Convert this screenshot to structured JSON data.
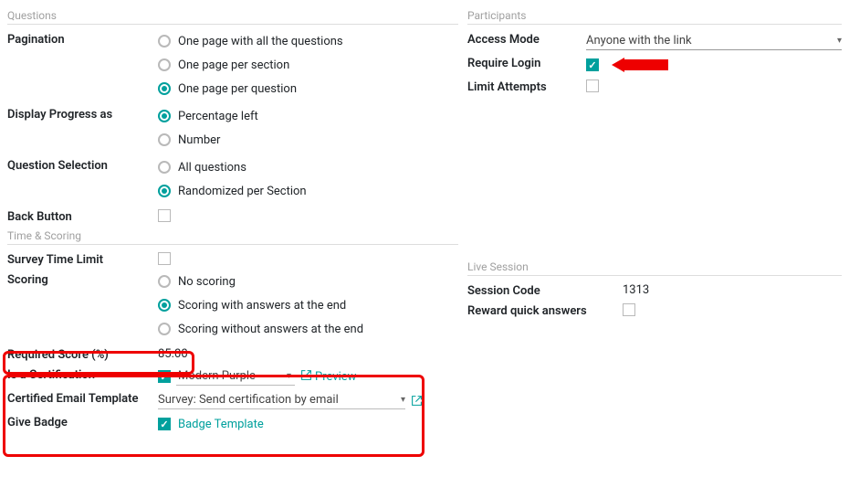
{
  "questions": {
    "header": "Questions",
    "pagination": {
      "label": "Pagination",
      "opt_all": "One page with all the questions",
      "opt_section": "One page per section",
      "opt_question": "One page per question"
    },
    "progress": {
      "label": "Display Progress as",
      "opt_percent": "Percentage left",
      "opt_number": "Number"
    },
    "selection": {
      "label": "Question Selection",
      "opt_all": "All questions",
      "opt_random": "Randomized per Section"
    },
    "back": {
      "label": "Back Button"
    }
  },
  "time_scoring": {
    "header": "Time & Scoring",
    "time_limit": {
      "label": "Survey Time Limit"
    },
    "scoring": {
      "label": "Scoring",
      "opt_none": "No scoring",
      "opt_with": "Scoring with answers at the end",
      "opt_without": "Scoring without answers at the end"
    },
    "required_score": {
      "label": "Required Score (%)",
      "value": "85.00"
    },
    "is_cert": {
      "label": "Is a Certification",
      "template": "Modern Purple",
      "preview": "Preview"
    },
    "email_template": {
      "label": "Certified Email Template",
      "value": "Survey: Send certification by email"
    },
    "give_badge": {
      "label": "Give Badge",
      "link": "Badge Template"
    }
  },
  "participants": {
    "header": "Participants",
    "access_mode": {
      "label": "Access Mode",
      "value": "Anyone with the link"
    },
    "require_login": {
      "label": "Require Login"
    },
    "limit_attempts": {
      "label": "Limit Attempts"
    }
  },
  "live_session": {
    "header": "Live Session",
    "session_code": {
      "label": "Session Code",
      "value": "1313"
    },
    "reward": {
      "label": "Reward quick answers"
    }
  }
}
